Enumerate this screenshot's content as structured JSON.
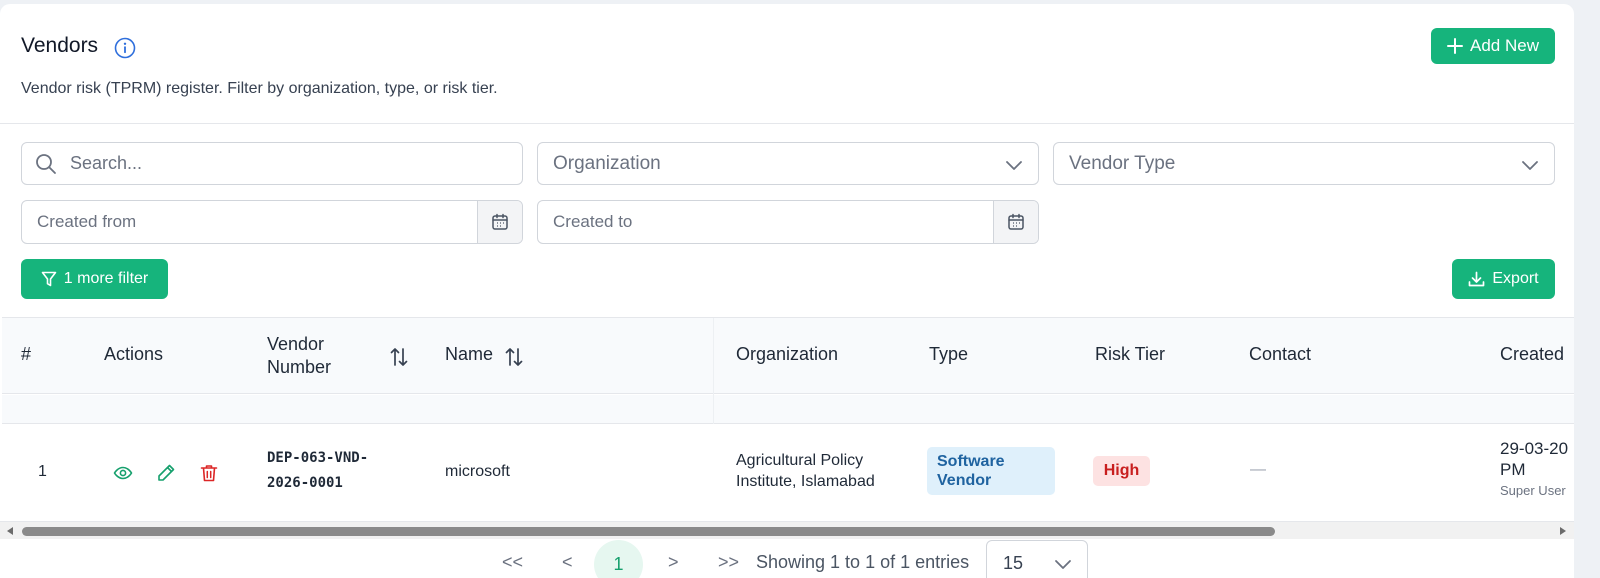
{
  "header": {
    "title": "Vendors",
    "subtitle": "Vendor risk (TPRM) register. Filter by organization, type, or risk tier.",
    "add_button": "Add New"
  },
  "filters": {
    "search_placeholder": "Search...",
    "organization_placeholder": "Organization",
    "vendor_type_placeholder": "Vendor Type",
    "created_from_placeholder": "Created from",
    "created_to_placeholder": "Created to",
    "more_filter_button": "1 more filter",
    "export_button": "Export"
  },
  "table": {
    "columns": [
      "#",
      "Actions",
      "Vendor Number",
      "Name",
      "Organization",
      "Type",
      "Risk Tier",
      "Contact",
      "Created"
    ],
    "vendor_number_header_line1": "Vendor",
    "vendor_number_header_line2": "Number",
    "rows": [
      {
        "index": "1",
        "vendor_number_line1": "DEP-063-VND-",
        "vendor_number_line2": "2026-0001",
        "name": "microsoft",
        "organization_line1": "Agricultural Policy",
        "organization_line2": "Institute, Islamabad",
        "type_line1": "Software",
        "type_line2": "Vendor",
        "risk_tier": "High",
        "contact": "—",
        "created_line1": "29-03-20",
        "created_line2": "PM",
        "created_by": "Super User"
      }
    ]
  },
  "pagination": {
    "first": "<<",
    "prev": "<",
    "current_page": "1",
    "next": ">",
    "last": ">>",
    "entries_text": "Showing 1 to 1 of 1 entries",
    "per_page": "15"
  },
  "colors": {
    "accent": "#16b47c",
    "risk_high_bg": "#fde2e2",
    "risk_high_text": "#c81e1e",
    "type_badge_bg": "#dff0fb",
    "type_badge_text": "#1f63a0"
  }
}
